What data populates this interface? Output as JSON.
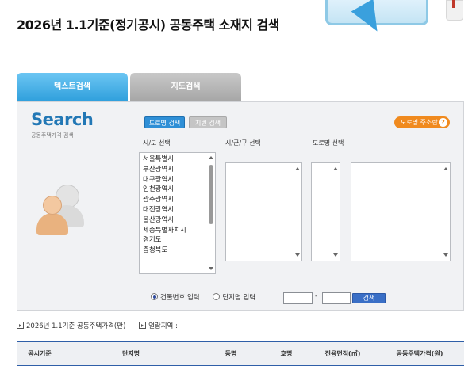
{
  "page_title": "2026년 1.1기준(정기공시) 공동주택 소재지 검색",
  "tabs": [
    {
      "label": "텍스트검색",
      "active": true
    },
    {
      "label": "지도검색",
      "active": false
    }
  ],
  "panel": {
    "logo": "Search",
    "logo_sub": "공동주택가격 검색",
    "road_search_btn": "도로명 검색",
    "jibun_search_btn": "지번 검색",
    "guide_btn": "도로명 주소란",
    "guide_icon": "?",
    "sido_label": "시/도 선택",
    "sigungu_label": "시/군/구 선택",
    "road_label": "도로명 선택",
    "sido_options": [
      "서울특별시",
      "부산광역시",
      "대구광역시",
      "인천광역시",
      "광주광역시",
      "대전광역시",
      "울산광역시",
      "세종특별자치시",
      "경기도",
      "충청북도"
    ],
    "radio_building": "건물번호 입력",
    "radio_complex": "단지명 입력",
    "number_separator": "-",
    "search_btn": "검색"
  },
  "info": {
    "price_label": "2026년 1.1기준 공동주택가격(만)",
    "region_label": "열람지역 :"
  },
  "table": {
    "columns": [
      "공시기준",
      "단지명",
      "동명",
      "호명",
      "전용면적(㎡)",
      "공동주택가격(원)"
    ]
  },
  "colors": {
    "accent_blue": "#2f8fd6",
    "tab_active": "#3aa8e4",
    "guide_orange": "#f08a1e",
    "logo_blue": "#2378b5"
  }
}
